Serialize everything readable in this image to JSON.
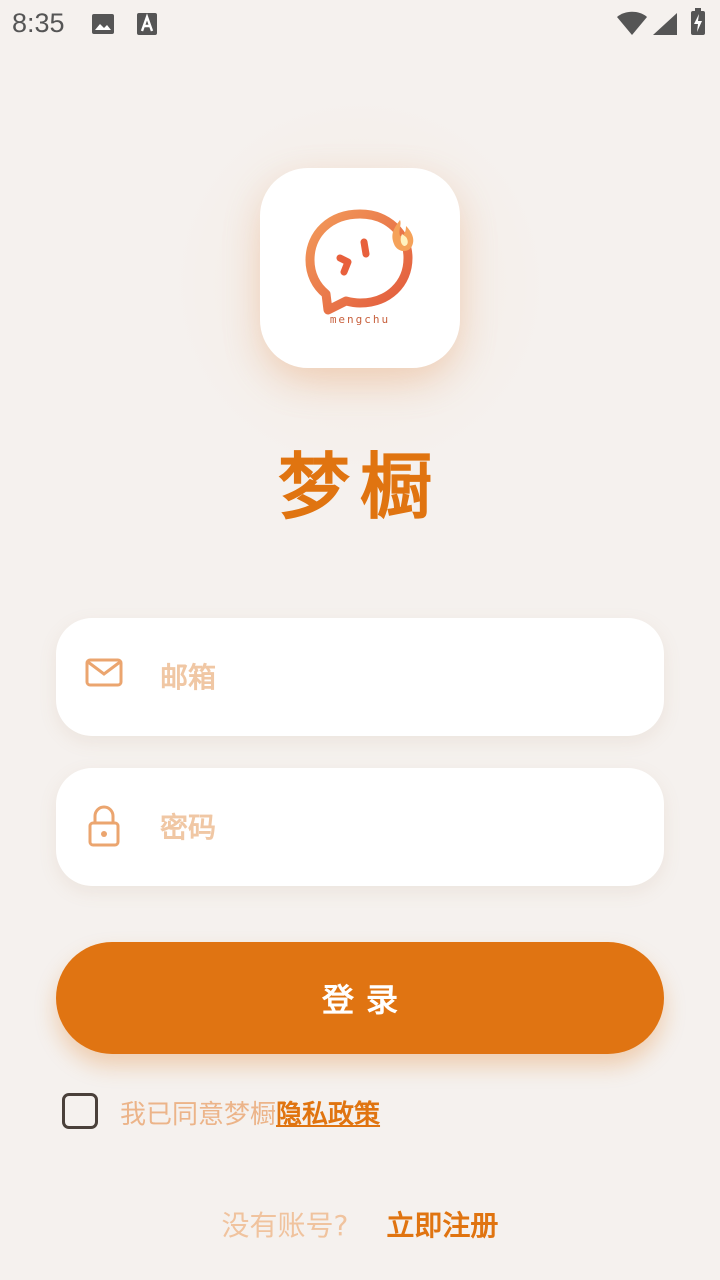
{
  "status_bar": {
    "time": "8:35",
    "left_icons": [
      "image-icon",
      "text-a-icon"
    ],
    "right_icons": [
      "wifi-icon",
      "signal-icon",
      "battery-charging-icon"
    ]
  },
  "logo": {
    "wordmark": "mengchu",
    "colors": {
      "flame": "#f5a25a",
      "bubble": "#e8603c"
    }
  },
  "app_name": "梦橱",
  "form": {
    "email": {
      "placeholder": "邮箱",
      "value": "",
      "icon": "mail-icon"
    },
    "password": {
      "placeholder": "密码",
      "value": "",
      "icon": "lock-icon"
    },
    "login_label": "登录"
  },
  "agreement": {
    "checked": false,
    "text": "我已同意梦橱",
    "link": "隐私政策"
  },
  "register": {
    "prompt": "没有账号?",
    "link": "立即注册"
  },
  "colors": {
    "accent": "#e07412",
    "placeholder": "#f0c7a4",
    "background": "#f5f1ee"
  }
}
